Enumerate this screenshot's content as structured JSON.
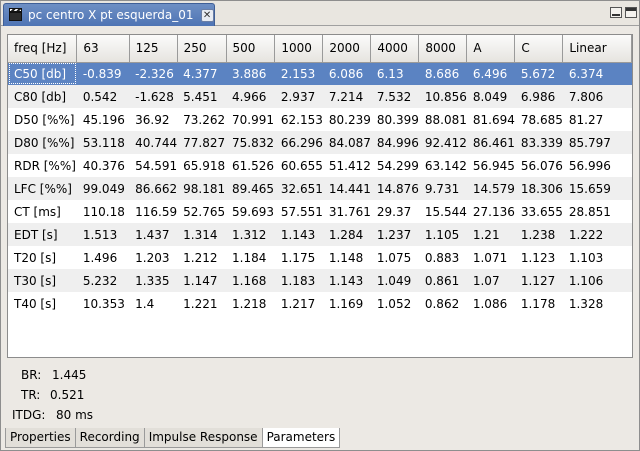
{
  "window": {
    "doc_tab_title": "pc centro X pt esquerda_01",
    "close_glyph": "✕"
  },
  "table": {
    "headers": [
      "freq [Hz]",
      "63",
      "125",
      "250",
      "500",
      "1000",
      "2000",
      "4000",
      "8000",
      "A",
      "C",
      "Linear"
    ],
    "rows": [
      [
        "C50 [db]",
        "-0.839",
        "-2.326",
        "4.377",
        "3.886",
        "2.153",
        "6.086",
        "6.13",
        "8.686",
        "6.496",
        "5.672",
        "6.374"
      ],
      [
        "C80 [db]",
        "0.542",
        "-1.628",
        "5.451",
        "4.966",
        "2.937",
        "7.214",
        "7.532",
        "10.856",
        "8.049",
        "6.986",
        "7.806"
      ],
      [
        "D50 [%%]",
        "45.196",
        "36.92",
        "73.262",
        "70.991",
        "62.153",
        "80.239",
        "80.399",
        "88.081",
        "81.694",
        "78.685",
        "81.27"
      ],
      [
        "D80 [%%]",
        "53.118",
        "40.744",
        "77.827",
        "75.832",
        "66.296",
        "84.087",
        "84.996",
        "92.412",
        "86.461",
        "83.339",
        "85.797"
      ],
      [
        "RDR [%%]",
        "40.376",
        "54.591",
        "65.918",
        "61.526",
        "60.655",
        "51.412",
        "54.299",
        "63.142",
        "56.945",
        "56.076",
        "56.996"
      ],
      [
        "LFC [%%]",
        "99.049",
        "86.662",
        "98.181",
        "89.465",
        "32.651",
        "14.441",
        "14.876",
        "9.731",
        "14.579",
        "18.306",
        "15.659"
      ],
      [
        "CT [ms]",
        "110.18",
        "116.59",
        "52.765",
        "59.693",
        "57.551",
        "31.761",
        "29.37",
        "15.544",
        "27.136",
        "33.655",
        "28.851"
      ],
      [
        "EDT [s]",
        "1.513",
        "1.437",
        "1.314",
        "1.312",
        "1.143",
        "1.284",
        "1.237",
        "1.105",
        "1.21",
        "1.238",
        "1.222"
      ],
      [
        "T20 [s]",
        "1.496",
        "1.203",
        "1.212",
        "1.184",
        "1.175",
        "1.148",
        "1.075",
        "0.883",
        "1.071",
        "1.123",
        "1.103"
      ],
      [
        "T30 [s]",
        "5.232",
        "1.335",
        "1.147",
        "1.168",
        "1.183",
        "1.143",
        "1.049",
        "0.861",
        "1.07",
        "1.127",
        "1.106"
      ],
      [
        "T40 [s]",
        "10.353",
        "1.4",
        "1.221",
        "1.218",
        "1.217",
        "1.169",
        "1.052",
        "0.862",
        "1.086",
        "1.178",
        "1.328"
      ]
    ],
    "selected_row": 0
  },
  "info": {
    "br_label": "BR:",
    "br_value": "1.445",
    "tr_label": "TR:",
    "tr_value": "0.521",
    "itdg_label": "ITDG:",
    "itdg_value": "80 ms"
  },
  "bottom_tabs": [
    {
      "label": "Properties",
      "active": false
    },
    {
      "label": "Recording",
      "active": false
    },
    {
      "label": "Impulse Response",
      "active": false
    },
    {
      "label": "Parameters",
      "active": true
    }
  ],
  "colors": {
    "selection": "#5b83c2",
    "tab_active": "#4e74b4"
  }
}
